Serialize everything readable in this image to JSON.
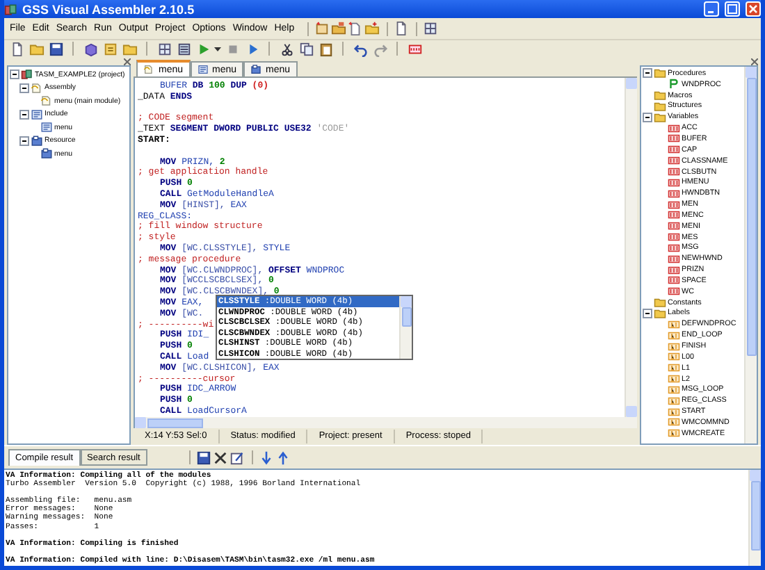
{
  "window": {
    "title": "GSS Visual Assembler 2.10.5"
  },
  "menu": [
    "File",
    "Edit",
    "Search",
    "Run",
    "Output",
    "Project",
    "Options",
    "Window",
    "Help"
  ],
  "project_tree": [
    {
      "label": "TASM_EXAMPLE2 (project)",
      "kind": "project",
      "expanded": true,
      "children": [
        {
          "label": "Assembly",
          "kind": "assembly",
          "expanded": true,
          "children": [
            {
              "label": "menu (main module)",
              "kind": "asmfile"
            }
          ]
        },
        {
          "label": "Include",
          "kind": "include",
          "expanded": true,
          "children": [
            {
              "label": "menu",
              "kind": "incfile"
            }
          ]
        },
        {
          "label": "Resource",
          "kind": "resource",
          "expanded": true,
          "children": [
            {
              "label": "menu",
              "kind": "resfile"
            }
          ]
        }
      ]
    }
  ],
  "editor_tabs": [
    {
      "label": "menu",
      "kind": "asmfile",
      "selected": true
    },
    {
      "label": "menu",
      "kind": "incfile",
      "selected": false
    },
    {
      "label": "menu",
      "kind": "resfile",
      "selected": false
    }
  ],
  "code": [
    {
      "kind": "code",
      "indent": true,
      "tokens": [
        {
          "text": "BUFER",
          "kind": "id"
        },
        {
          "text": "DB",
          "kind": "kw"
        },
        {
          "text": "100",
          "kind": "num"
        },
        {
          "text": "DUP",
          "kind": "kw"
        },
        {
          "text": "(0)",
          "kind": "br"
        }
      ]
    },
    {
      "kind": "code",
      "indent": false,
      "tokens": [
        {
          "text": "_DATA",
          "kind": "plain"
        },
        {
          "text": "ENDS",
          "kind": "kw"
        }
      ]
    },
    {
      "kind": "blank"
    },
    {
      "kind": "code",
      "indent": false,
      "tokens": [
        {
          "text": "; CODE segment",
          "kind": "cm"
        }
      ]
    },
    {
      "kind": "code",
      "indent": false,
      "tokens": [
        {
          "text": "_TEXT",
          "kind": "plain"
        },
        {
          "text": "SEGMENT DWORD PUBLIC USE32",
          "kind": "kw"
        },
        {
          "text": "'CODE'",
          "kind": "str"
        }
      ]
    },
    {
      "kind": "code",
      "indent": false,
      "tokens": [
        {
          "text": "START:",
          "kind": "lbl"
        }
      ]
    },
    {
      "kind": "blank"
    },
    {
      "kind": "code",
      "indent": true,
      "tokens": [
        {
          "text": "MOV",
          "kind": "kw"
        },
        {
          "text": "PRIZN,",
          "kind": "id"
        },
        {
          "text": "2",
          "kind": "num"
        }
      ]
    },
    {
      "kind": "code",
      "indent": false,
      "tokens": [
        {
          "text": "; get application handle",
          "kind": "cm"
        }
      ]
    },
    {
      "kind": "code",
      "indent": true,
      "tokens": [
        {
          "text": "PUSH",
          "kind": "kw"
        },
        {
          "text": "0",
          "kind": "num"
        }
      ]
    },
    {
      "kind": "code",
      "indent": true,
      "tokens": [
        {
          "text": "CALL",
          "kind": "kw"
        },
        {
          "text": "GetModuleHandleA",
          "kind": "id"
        }
      ]
    },
    {
      "kind": "code",
      "indent": true,
      "tokens": [
        {
          "text": "MOV",
          "kind": "kw"
        },
        {
          "text": "[HINST],",
          "kind": "mem"
        },
        {
          "text": "EAX",
          "kind": "id"
        }
      ]
    },
    {
      "kind": "code",
      "indent": false,
      "tokens": [
        {
          "text": "REG_CLASS:",
          "kind": "id"
        }
      ]
    },
    {
      "kind": "code",
      "indent": false,
      "tokens": [
        {
          "text": "; fill window structure",
          "kind": "cm"
        }
      ]
    },
    {
      "kind": "code",
      "indent": false,
      "tokens": [
        {
          "text": "; style",
          "kind": "cm"
        }
      ]
    },
    {
      "kind": "code",
      "indent": true,
      "tokens": [
        {
          "text": "MOV",
          "kind": "kw"
        },
        {
          "text": "[WC.CLSSTYLE],",
          "kind": "mem"
        },
        {
          "text": "STYLE",
          "kind": "id"
        }
      ]
    },
    {
      "kind": "code",
      "indent": false,
      "tokens": [
        {
          "text": "; message procedure",
          "kind": "cm"
        }
      ]
    },
    {
      "kind": "code",
      "indent": true,
      "tokens": [
        {
          "text": "MOV",
          "kind": "kw"
        },
        {
          "text": "[WC.CLWNDPROC],",
          "kind": "mem"
        },
        {
          "text": "OFFSET",
          "kind": "kw"
        },
        {
          "text": "WNDPROC",
          "kind": "id"
        }
      ]
    },
    {
      "kind": "code",
      "indent": true,
      "tokens": [
        {
          "text": "MOV",
          "kind": "kw"
        },
        {
          "text": "[WCCLSCBCLSEX],",
          "kind": "mem"
        },
        {
          "text": "0",
          "kind": "num"
        }
      ]
    },
    {
      "kind": "code",
      "indent": true,
      "tokens": [
        {
          "text": "MOV",
          "kind": "kw"
        },
        {
          "text": "[WC.CLSCBWNDEX],",
          "kind": "mem"
        },
        {
          "text": "0",
          "kind": "num"
        }
      ]
    },
    {
      "kind": "code",
      "indent": true,
      "tokens": [
        {
          "text": "MOV",
          "kind": "kw"
        },
        {
          "text": "EAX,",
          "kind": "id"
        }
      ]
    },
    {
      "kind": "code",
      "indent": true,
      "tokens": [
        {
          "text": "MOV",
          "kind": "kw"
        },
        {
          "text": "[WC.",
          "kind": "mem"
        }
      ]
    },
    {
      "kind": "code",
      "indent": false,
      "tokens": [
        {
          "text": "; ----------wi",
          "kind": "cm"
        }
      ]
    },
    {
      "kind": "code",
      "indent": true,
      "tokens": [
        {
          "text": "PUSH",
          "kind": "kw"
        },
        {
          "text": "IDI_",
          "kind": "id"
        }
      ]
    },
    {
      "kind": "code",
      "indent": true,
      "tokens": [
        {
          "text": "PUSH",
          "kind": "kw"
        },
        {
          "text": "0",
          "kind": "num"
        }
      ]
    },
    {
      "kind": "code",
      "indent": true,
      "tokens": [
        {
          "text": "CALL",
          "kind": "kw"
        },
        {
          "text": "Load",
          "kind": "id"
        }
      ]
    },
    {
      "kind": "code",
      "indent": true,
      "tokens": [
        {
          "text": "MOV",
          "kind": "kw"
        },
        {
          "text": "[WC.CLSHICON],",
          "kind": "mem"
        },
        {
          "text": "EAX",
          "kind": "id"
        }
      ]
    },
    {
      "kind": "code",
      "indent": false,
      "tokens": [
        {
          "text": "; ----------cursor",
          "kind": "cm"
        }
      ]
    },
    {
      "kind": "code",
      "indent": true,
      "tokens": [
        {
          "text": "PUSH",
          "kind": "kw"
        },
        {
          "text": "IDC_ARROW",
          "kind": "id"
        }
      ]
    },
    {
      "kind": "code",
      "indent": true,
      "tokens": [
        {
          "text": "PUSH",
          "kind": "kw"
        },
        {
          "text": "0",
          "kind": "num"
        }
      ]
    },
    {
      "kind": "code",
      "indent": true,
      "tokens": [
        {
          "text": "CALL",
          "kind": "kw"
        },
        {
          "text": "LoadCursorA",
          "kind": "id"
        }
      ]
    }
  ],
  "completion": [
    {
      "text": "**CLSSTYLE** :DOUBLE WORD (4b)",
      "selected": true
    },
    {
      "text": "**CLWNDPROC** :DOUBLE WORD (4b)",
      "selected": false
    },
    {
      "text": "**CLSCBCLSEX** :DOUBLE WORD (4b)",
      "selected": false
    },
    {
      "text": "**CLSCBWNDEX** :DOUBLE WORD (4b)",
      "selected": false
    },
    {
      "text": "**CLSHINST** :DOUBLE WORD (4b)",
      "selected": false
    },
    {
      "text": "**CLSHICON** :DOUBLE WORD (4b)",
      "selected": false
    }
  ],
  "status_bar": [
    "X:14 Y:53 Sel:0",
    "Status: modified",
    "Project: present",
    "Process: stoped"
  ],
  "symbols": [
    {
      "label": "Procedures",
      "kind": "folder",
      "expanded": true,
      "children": [
        {
          "label": "WNDPROC",
          "kind": "procedure"
        }
      ]
    },
    {
      "label": "Macros",
      "kind": "folder"
    },
    {
      "label": "Structures",
      "kind": "folder"
    },
    {
      "label": "Variables",
      "kind": "folder",
      "expanded": true,
      "children": [
        {
          "label": "ACC",
          "kind": "variable"
        },
        {
          "label": "BUFER",
          "kind": "variable"
        },
        {
          "label": "CAP",
          "kind": "variable"
        },
        {
          "label": "CLASSNAME",
          "kind": "variable"
        },
        {
          "label": "CLSBUTN",
          "kind": "variable"
        },
        {
          "label": "HMENU",
          "kind": "variable"
        },
        {
          "label": "HWNDBTN",
          "kind": "variable"
        },
        {
          "label": "MEN",
          "kind": "variable"
        },
        {
          "label": "MENC",
          "kind": "variable"
        },
        {
          "label": "MENI",
          "kind": "variable"
        },
        {
          "label": "MES",
          "kind": "variable"
        },
        {
          "label": "MSG",
          "kind": "variable"
        },
        {
          "label": "NEWHWND",
          "kind": "variable"
        },
        {
          "label": "PRIZN",
          "kind": "variable"
        },
        {
          "label": "SPACE",
          "kind": "variable"
        },
        {
          "label": "WC",
          "kind": "variable"
        }
      ]
    },
    {
      "label": "Constants",
      "kind": "folder"
    },
    {
      "label": "Labels",
      "kind": "folder",
      "expanded": true,
      "children": [
        {
          "label": "DEFWNDPROC",
          "kind": "label"
        },
        {
          "label": "END_LOOP",
          "kind": "label"
        },
        {
          "label": "FINISH",
          "kind": "label"
        },
        {
          "label": "L00",
          "kind": "label"
        },
        {
          "label": "L1",
          "kind": "label"
        },
        {
          "label": "L2",
          "kind": "label"
        },
        {
          "label": "MSG_LOOP",
          "kind": "label"
        },
        {
          "label": "REG_CLASS",
          "kind": "label"
        },
        {
          "label": "START",
          "kind": "label"
        },
        {
          "label": "WMCOMMND",
          "kind": "label"
        },
        {
          "label": "WMCREATE",
          "kind": "label"
        }
      ]
    }
  ],
  "output_tabs": [
    {
      "label": "Compile result",
      "selected": true
    },
    {
      "label": "Search result",
      "selected": false
    }
  ],
  "output": [
    {
      "kind": "info",
      "text": "VA Information: Compiling all of the modules"
    },
    {
      "kind": "plain",
      "text": "Turbo Assembler  Version 5.0  Copyright (c) 1988, 1996 Borland International"
    },
    {
      "kind": "blank"
    },
    {
      "kind": "plain",
      "text": "Assembling file:   menu.asm"
    },
    {
      "kind": "plain",
      "text": "Error messages:    None"
    },
    {
      "kind": "plain",
      "text": "Warning messages:  None"
    },
    {
      "kind": "plain",
      "text": "Passes:            1"
    },
    {
      "kind": "blank"
    },
    {
      "kind": "info",
      "text": "VA Information: Compiling is finished"
    },
    {
      "kind": "blank"
    },
    {
      "kind": "info",
      "text": "VA Information: Compiled with line: D:\\Disasem\\TASM\\bin\\tasm32.exe /ml menu.asm"
    }
  ]
}
